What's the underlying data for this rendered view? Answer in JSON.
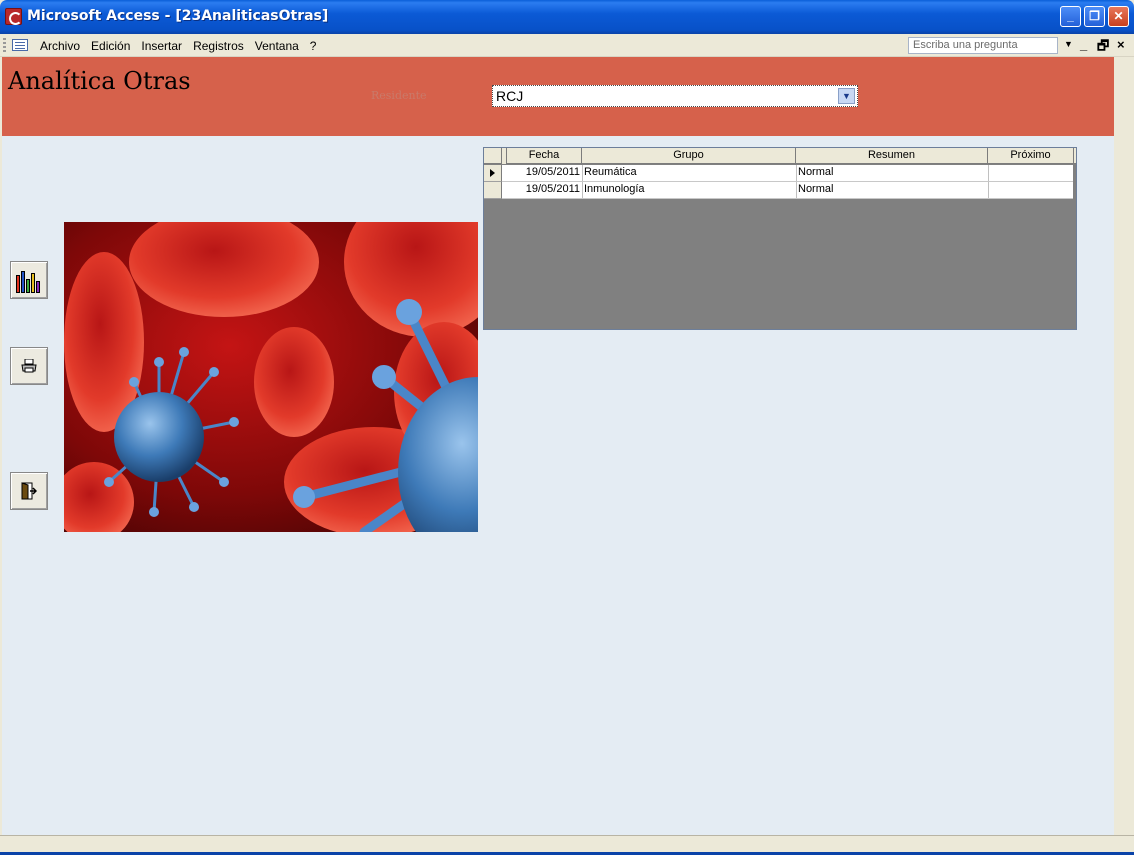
{
  "window": {
    "title": "Microsoft Access - [23AnaliticasOtras]",
    "min_label": "_",
    "max_label": "❐",
    "close_label": "✕"
  },
  "menu": {
    "items": [
      "Archivo",
      "Edición",
      "Insertar",
      "Registros",
      "Ventana",
      "?"
    ],
    "ask_placeholder": "Escriba una pregunta",
    "mdi_min": "_",
    "mdi_restore": "🗗",
    "mdi_close": "×"
  },
  "form": {
    "title": "Analítica Otras",
    "residente_label": "Residente",
    "residente_value": "RCJ",
    "buttons": [
      {
        "name": "chart-button",
        "icon": "chart-icon"
      },
      {
        "name": "print-button",
        "icon": "printer-icon"
      },
      {
        "name": "exit-button",
        "icon": "exit-door-icon"
      }
    ]
  },
  "datasheet": {
    "columns": [
      "Fecha",
      "Grupo",
      "Resumen",
      "Próximo"
    ],
    "rows": [
      {
        "fecha": "19/05/2011",
        "grupo": "Reumática",
        "resumen": "Normal",
        "proximo": ""
      },
      {
        "fecha": "19/05/2011",
        "grupo": "Inmunología",
        "resumen": "Normal",
        "proximo": ""
      }
    ]
  },
  "colors": {
    "header_bg": "#d6614b",
    "form_bg": "#e4ecf3",
    "titlebar": "#0b5ad6"
  }
}
